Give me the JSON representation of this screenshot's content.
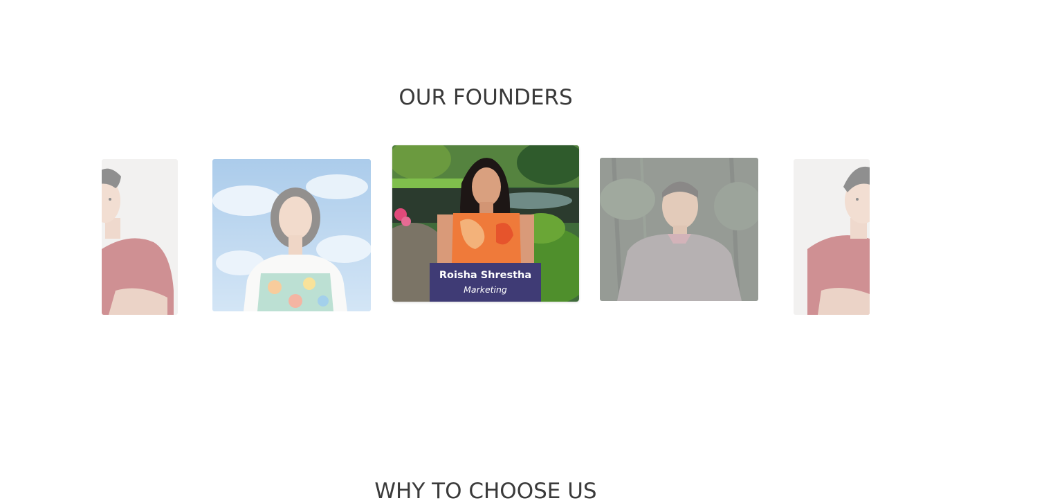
{
  "founders_section": {
    "title": "OUR FOUNDERS",
    "carousel": {
      "active_index": 2,
      "slides": [
        {
          "photo": "man-red-polo-photo",
          "state": "faded-partial"
        },
        {
          "photo": "woman-sky-background-photo",
          "state": "faded"
        },
        {
          "photo": "woman-garden-photo",
          "state": "active",
          "name": "Roisha Shrestha",
          "role": "Marketing"
        },
        {
          "photo": "man-sweater-trees-photo",
          "state": "faded"
        },
        {
          "photo": "man-red-polo-photo",
          "state": "faded-partial"
        }
      ]
    },
    "caption_color": "#3f3b75"
  },
  "why_section": {
    "title": "WHY TO CHOOSE US"
  }
}
